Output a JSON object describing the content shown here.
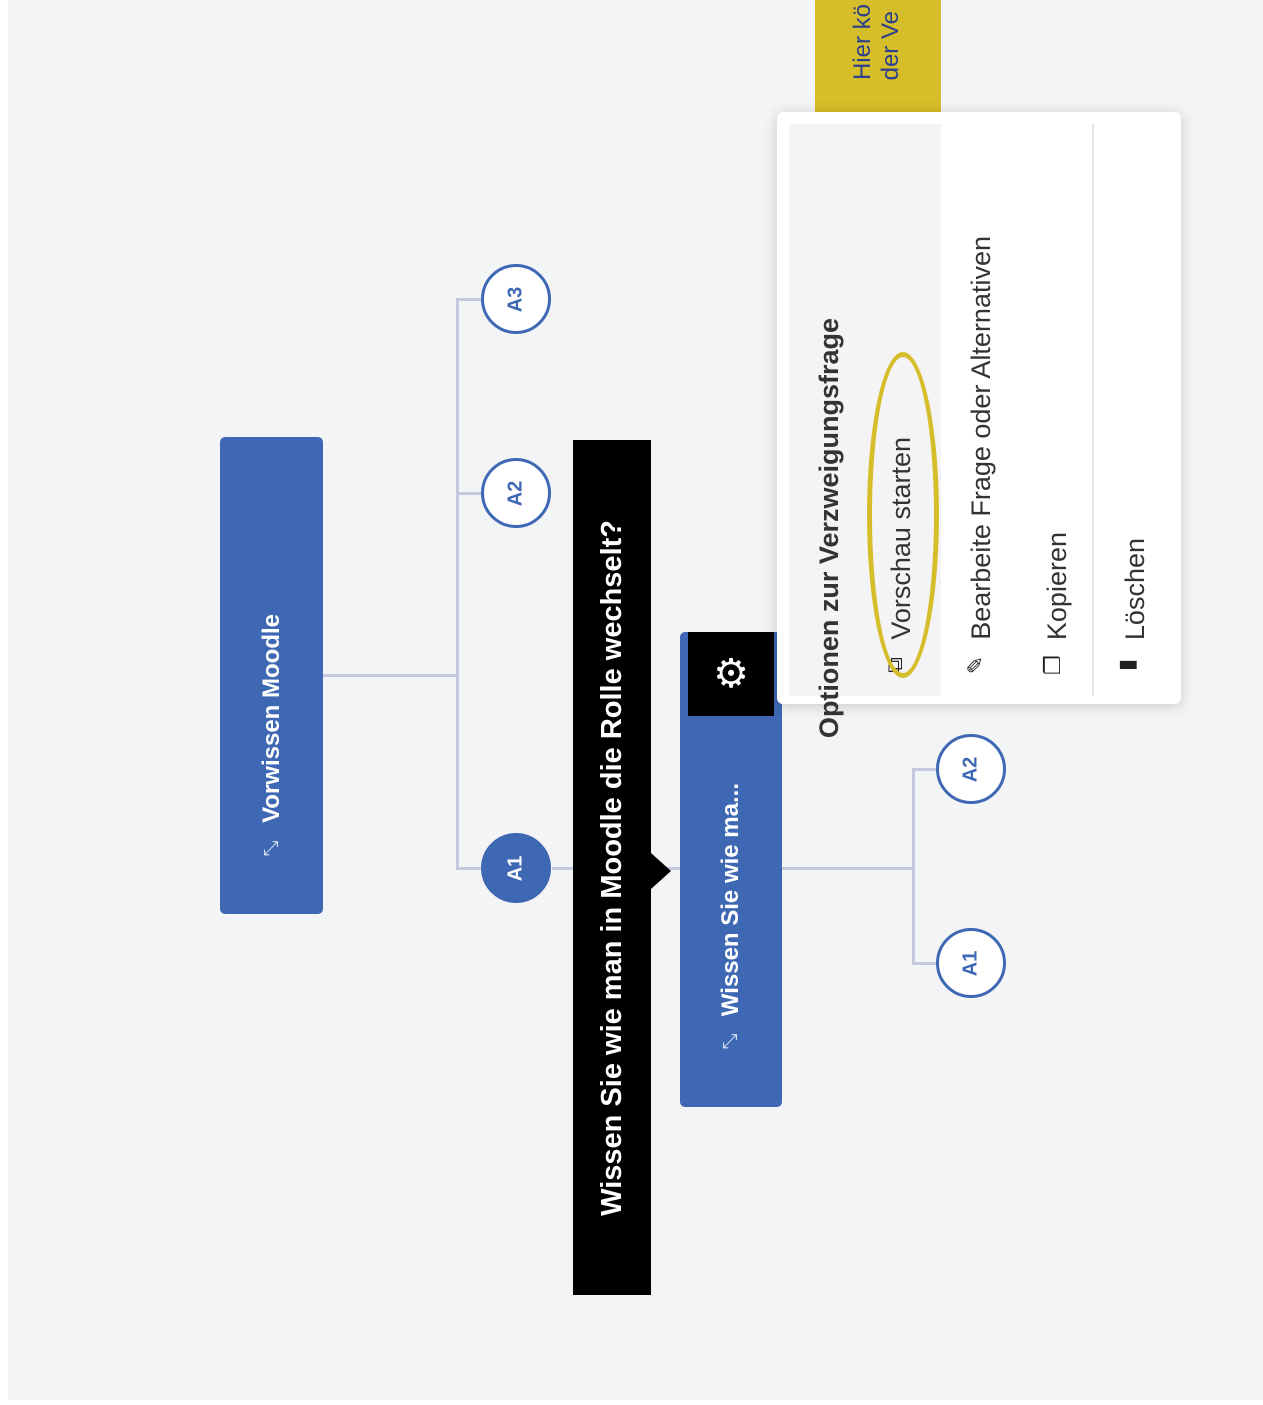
{
  "nodes": {
    "root": {
      "label": "Vorwissen Moodle",
      "icon": "branch-icon"
    },
    "child": {
      "label": "Wissen Sie wie ma...",
      "icon": "branch-icon"
    }
  },
  "answers": {
    "root_a1": "A1",
    "root_a2": "A2",
    "root_a3": "A3",
    "child_a1": "A1",
    "child_a2": "A2"
  },
  "tooltip": "Wissen Sie wie man in Moodle die Rolle wechselt?",
  "menu": {
    "header": "Optionen zur Verzweigungsfrage",
    "items": [
      {
        "label": "Vorschau starten",
        "icon": "preview-icon"
      },
      {
        "label": "Bearbeite Frage oder Alternativen",
        "icon": "pencil-icon"
      },
      {
        "label": "Kopieren",
        "icon": "copy-icon"
      },
      {
        "label": "Löschen",
        "icon": "trash-icon"
      }
    ]
  },
  "callout": {
    "line1": "Hier kö",
    "line2": "der Ve"
  },
  "colors": {
    "node": "#3e68b3",
    "highlight": "#d6bd2a",
    "tooltip": "#000000"
  }
}
